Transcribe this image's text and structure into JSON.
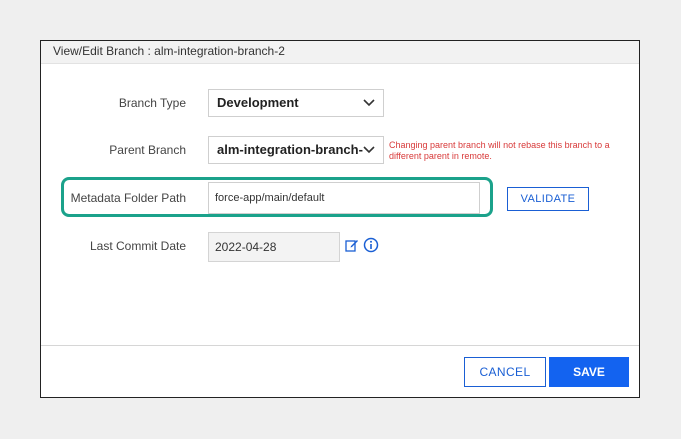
{
  "dialog": {
    "title": "View/Edit Branch : alm-integration-branch-2"
  },
  "form": {
    "branch_type": {
      "label": "Branch Type",
      "value": "Development"
    },
    "parent_branch": {
      "label": "Parent Branch",
      "value": "alm-integration-branch-",
      "warning": "Changing parent branch will not rebase this branch to a different parent in remote."
    },
    "metadata_folder": {
      "label": "Metadata Folder Path",
      "value": "force-app/main/default",
      "validate_label": "VALIDATE"
    },
    "last_commit": {
      "label": "Last Commit Date",
      "value": "2022-04-28"
    }
  },
  "footer": {
    "cancel_label": "CANCEL",
    "save_label": "SAVE"
  },
  "colors": {
    "accent_blue": "#1363f0",
    "highlight_green": "#1ba28b",
    "warning_red": "#d83a3a"
  },
  "icons": [
    "chevron-down-icon",
    "edit-icon",
    "info-icon"
  ]
}
